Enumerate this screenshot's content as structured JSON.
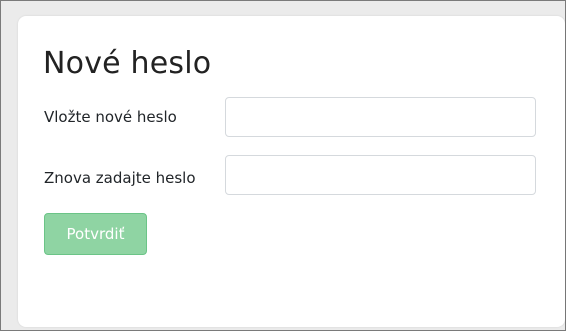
{
  "form": {
    "title": "Nové heslo",
    "new_password_label": "Vložte nové heslo",
    "new_password_value": "",
    "repeat_password_label": "Znova zadajte heslo",
    "repeat_password_value": "",
    "submit_label": "Potvrdiť"
  },
  "colors": {
    "button_bg": "#8fd4a3",
    "button_border": "#6bc487",
    "background": "#ebebeb",
    "card": "#ffffff"
  }
}
